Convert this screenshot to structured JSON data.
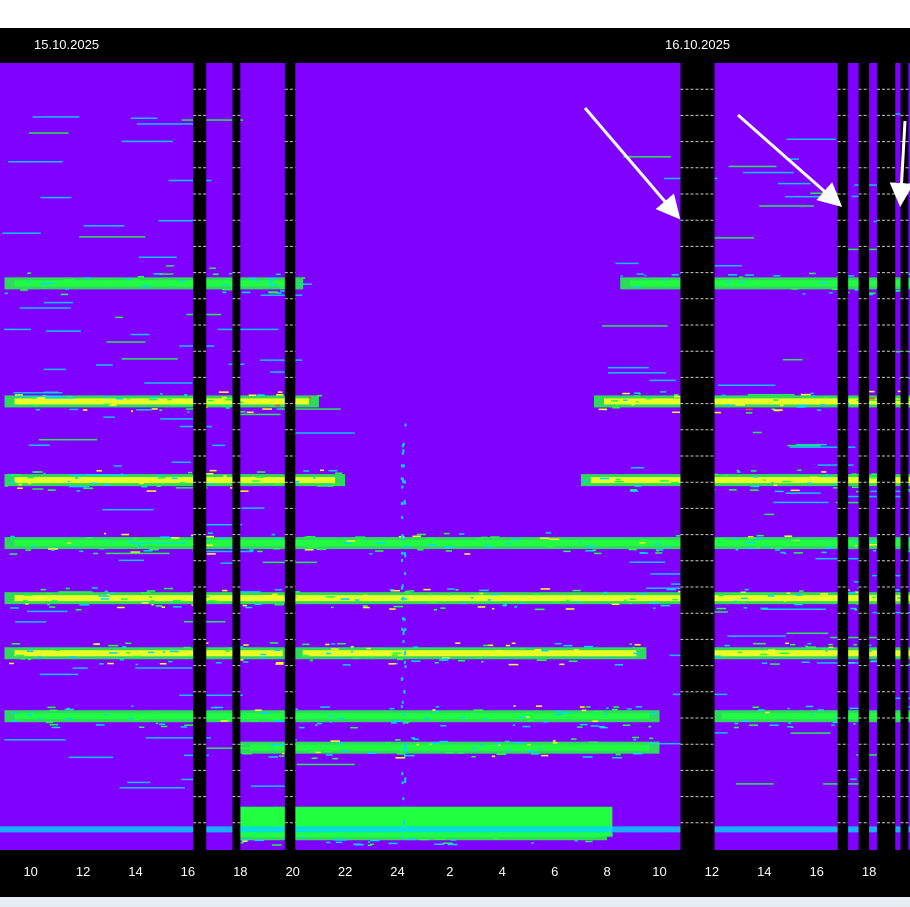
{
  "chart_data": {
    "type": "heatmap",
    "title": "",
    "xlabel": "",
    "ylabel": "",
    "date_labels": [
      {
        "text": "15.10.2025",
        "hour_offset": 0
      },
      {
        "text": "16.10.2025",
        "hour_offset": 24
      }
    ],
    "x_range_hours": [
      -1.2,
      32.0
    ],
    "x_ticks": [
      {
        "label": "10",
        "hour": 10
      },
      {
        "label": "12",
        "hour": 12
      },
      {
        "label": "14",
        "hour": 14
      },
      {
        "label": "16",
        "hour": 16
      },
      {
        "label": "18",
        "hour": 18
      },
      {
        "label": "20",
        "hour": 20
      },
      {
        "label": "22",
        "hour": 22
      },
      {
        "label": "24",
        "hour": 24
      },
      {
        "label": "2",
        "hour": 26
      },
      {
        "label": "4",
        "hour": 28
      },
      {
        "label": "6",
        "hour": 30
      },
      {
        "label": "8",
        "hour": 32
      },
      {
        "label": "10",
        "hour": 34
      },
      {
        "label": "12",
        "hour": 36
      },
      {
        "label": "14",
        "hour": 38
      },
      {
        "label": "16",
        "hour": 40
      },
      {
        "label": "18",
        "hour": 42
      }
    ],
    "data_gaps_hours": [
      [
        16.2,
        16.7
      ],
      [
        17.7,
        18.0
      ],
      [
        19.7,
        20.1
      ],
      [
        34.8,
        36.1
      ],
      [
        40.8,
        41.2
      ],
      [
        41.6,
        42.0
      ],
      [
        42.3,
        43.0
      ],
      [
        43.2,
        43.5
      ]
    ],
    "signal_bands": [
      {
        "level": 0.72,
        "intensity": 0.6,
        "spans": [
          [
            9.0,
            20.4
          ],
          [
            32.5,
            44.0
          ]
        ]
      },
      {
        "level": 0.57,
        "intensity": 0.85,
        "spans": [
          [
            9.0,
            21.0
          ],
          [
            31.5,
            44.0
          ]
        ]
      },
      {
        "level": 0.47,
        "intensity": 0.75,
        "spans": [
          [
            9.0,
            22.0
          ],
          [
            31.0,
            44.0
          ]
        ]
      },
      {
        "level": 0.39,
        "intensity": 0.7,
        "spans": [
          [
            9.0,
            44.0
          ]
        ]
      },
      {
        "level": 0.32,
        "intensity": 0.8,
        "spans": [
          [
            9.0,
            44.0
          ]
        ]
      },
      {
        "level": 0.25,
        "intensity": 0.8,
        "spans": [
          [
            9.0,
            20.0
          ],
          [
            20.0,
            33.5
          ],
          [
            35.5,
            44.0
          ]
        ]
      },
      {
        "level": 0.17,
        "intensity": 0.65,
        "spans": [
          [
            9.0,
            34.0
          ],
          [
            36.0,
            44.0
          ]
        ]
      },
      {
        "level": 0.13,
        "intensity": 0.7,
        "spans": [
          [
            18.0,
            34.0
          ]
        ]
      },
      {
        "level": 0.02,
        "intensity": 0.65,
        "spans": [
          [
            18.0,
            32.0
          ]
        ]
      }
    ],
    "colors": {
      "background": "#8000ff",
      "low": "#00d8ff",
      "mid": "#20ff40",
      "high": "#ffff20",
      "peak": "#ff4020",
      "gap": "#000000",
      "frame": "#000000"
    },
    "grid": true,
    "annotations": [
      {
        "type": "arrow",
        "points_to_gap": 3
      },
      {
        "type": "arrow",
        "points_to_gap": 4
      },
      {
        "type": "arrow",
        "points_to_gap": 7
      },
      {
        "type": "arrow",
        "points_to_gap": 7
      }
    ]
  }
}
